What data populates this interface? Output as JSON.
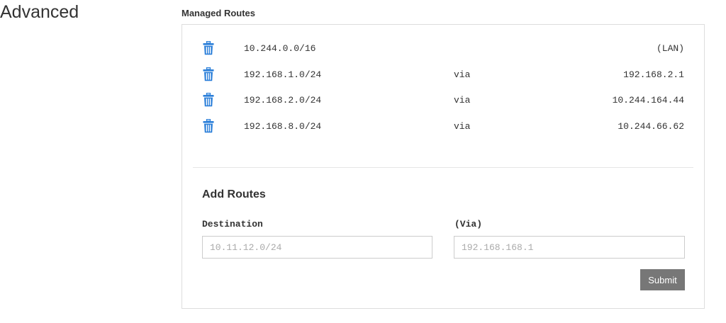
{
  "section": {
    "title": "Advanced"
  },
  "managed_routes": {
    "heading": "Managed Routes",
    "delete_icon": "trash-icon",
    "accent_color": "#2b7fd9",
    "rows": [
      {
        "destination": "10.244.0.0/16",
        "via": "",
        "gateway": "(LAN)"
      },
      {
        "destination": "192.168.1.0/24",
        "via": "via",
        "gateway": "192.168.2.1"
      },
      {
        "destination": "192.168.2.0/24",
        "via": "via",
        "gateway": "10.244.164.44"
      },
      {
        "destination": "192.168.8.0/24",
        "via": "via",
        "gateway": "10.244.66.62"
      }
    ]
  },
  "add_routes": {
    "heading": "Add Routes",
    "destination_label": "Destination",
    "destination_placeholder": "10.11.12.0/24",
    "destination_value": "",
    "via_label": "(Via)",
    "via_placeholder": "192.168.168.1",
    "via_value": "",
    "submit_label": "Submit",
    "submit_color": "#777777"
  }
}
